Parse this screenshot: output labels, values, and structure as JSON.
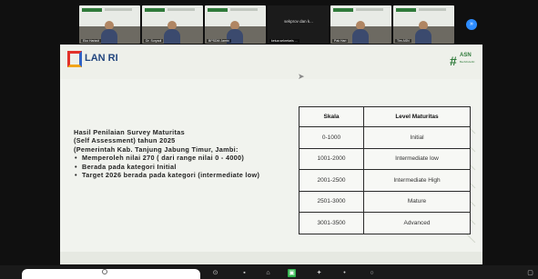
{
  "participants": [
    {
      "kind": "video",
      "name": "Eko Hariadi"
    },
    {
      "kind": "video",
      "name": "Dr. Suryadi"
    },
    {
      "kind": "video",
      "name": "BPSDM Jambi"
    },
    {
      "kind": "caption",
      "caption": "sekprov dan k...",
      "name": "ketua sekretaris ..."
    },
    {
      "kind": "video",
      "name": "Pak Hari"
    },
    {
      "kind": "video",
      "name": "Tim ASN"
    }
  ],
  "participants_more": "»",
  "slide": {
    "logo_text": "LAN RI",
    "asn_title": "ASN",
    "asn_subtitle": "BerAKHLAK",
    "intro_lines": [
      "Hasil Penilaian Survey Maturitas",
      "(Self Assessment) tahun 2025",
      "(Pemerintah Kab. Tanjung Jabung Timur, Jambi:"
    ],
    "bullets": [
      "Memperoleh nilai 270 ( dari range nilai 0 - 4000)",
      "Berada pada kategori Initial",
      "Target 2026 berada pada kategori (intermediate low)"
    ],
    "table": {
      "headers": [
        "Skala",
        "Level Maturitas"
      ],
      "rows": [
        [
          "0-1000",
          "Initial"
        ],
        [
          "1001-2000",
          "Intermediate low"
        ],
        [
          "2001-2500",
          "Intermediate High"
        ],
        [
          "2501-3000",
          "Mature"
        ],
        [
          "3001-3500",
          "Advanced"
        ]
      ]
    }
  },
  "toolbar": [
    {
      "icon": "mic-icon",
      "glyph": "⊙"
    },
    {
      "icon": "camera-icon",
      "glyph": "▪"
    },
    {
      "icon": "participants-icon",
      "glyph": "⌂"
    },
    {
      "icon": "share-icon",
      "glyph": "▣",
      "active": true
    },
    {
      "icon": "reactions-icon",
      "glyph": "✦"
    },
    {
      "icon": "more-icon",
      "glyph": "•"
    },
    {
      "icon": "settings-icon",
      "glyph": "○"
    },
    {
      "icon": "fullscreen-icon",
      "glyph": "▢"
    }
  ]
}
